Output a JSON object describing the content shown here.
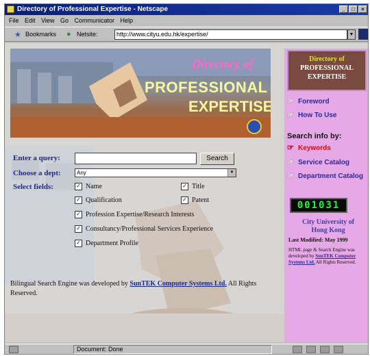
{
  "window": {
    "title": "Directory of Professional Expertise - Netscape"
  },
  "menu": [
    "File",
    "Edit",
    "View",
    "Go",
    "Communicator",
    "Help"
  ],
  "toolbar": {
    "bookmarks": "Bookmarks",
    "netsite_label": "Netsite:",
    "address": "http://www.cityu.edu.hk/expertise/"
  },
  "banner": {
    "line1": "Directory of",
    "line2": "PROFESSIONAL",
    "line3": "EXPERTISE"
  },
  "form": {
    "query_label": "Enter a query:",
    "query_value": "",
    "search_button": "Search",
    "dept_label": "Choose a dept:",
    "dept_value": "Any",
    "fields_label": "Select fields:",
    "fields": {
      "name": "Name",
      "title": "Title",
      "qualification": "Qualification",
      "patent": "Patent",
      "profession": "Profession Expertise/Research Interests",
      "consultancy": "Consultancy/Professional Services Experience",
      "department": "Department Profile"
    }
  },
  "footnote": {
    "prefix": "Bilingual Search Engine was developed by ",
    "link": "SunTEK Computer Systems Ltd.",
    "suffix": " All Rights Reserved."
  },
  "sidebar": {
    "header_line1": "Directory of",
    "header_line2": "PROFESSIONAL",
    "header_line3": "EXPERTISE",
    "foreword": "Foreword",
    "how_to_use": "How To Use",
    "search_by": "Search info by:",
    "keywords": "Keywords",
    "service_catalog": "Service Catalog",
    "department_catalog": "Department Catalog",
    "counter": "001031",
    "university_line1": "City University of",
    "university_line2": "Hong Kong",
    "updated": "Last Modified: May 1999",
    "copyright_prefix": "HTML page & Search Engine was developed by ",
    "copyright_link": "SunTEK Computer Systems Ltd.",
    "copyright_suffix": " All Rights Reserved."
  },
  "status": {
    "text": "Document: Done"
  },
  "colors": {
    "sidebar_bg": "#e7a8e7",
    "link": "#2a2aa0",
    "active_link": "#d01010",
    "label": "#1a2a8a",
    "counter": "#20f040"
  }
}
